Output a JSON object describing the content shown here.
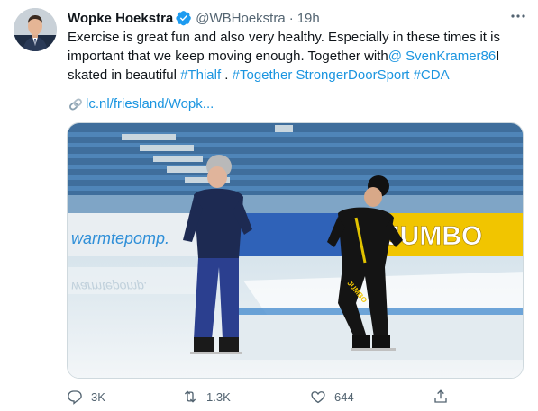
{
  "author": {
    "name": "Wopke Hoekstra",
    "handle": "@WBHoekstra",
    "separator": "·",
    "time": "19h"
  },
  "tweet": {
    "text_part1": "Exercise is great fun and also very healthy. Especially in these times it is important that we keep moving enough. Together with",
    "mention": "@ SvenKramer86",
    "text_part2": "I skated in beautiful ",
    "hashtag1": "#Thialf",
    "text_part3": " . ",
    "hashtag2": "#Together StrongerDoorSport",
    "text_part4": " ",
    "hashtag3": "#CDA",
    "link_text": "lc.nl/friesland/Wopk..."
  },
  "media": {
    "banner_left": "warmtepomp.",
    "banner_left_reflection": "warmtepomp.",
    "banner_jumbo": "JUMBO",
    "jacket_text": "JUMBO"
  },
  "actions": {
    "reply_count": "3K",
    "retweet_count": "1.3K",
    "like_count": "644"
  },
  "colors": {
    "link": "#1b95e0",
    "secondary_text": "#536471",
    "verified": "#1d9bf0"
  }
}
